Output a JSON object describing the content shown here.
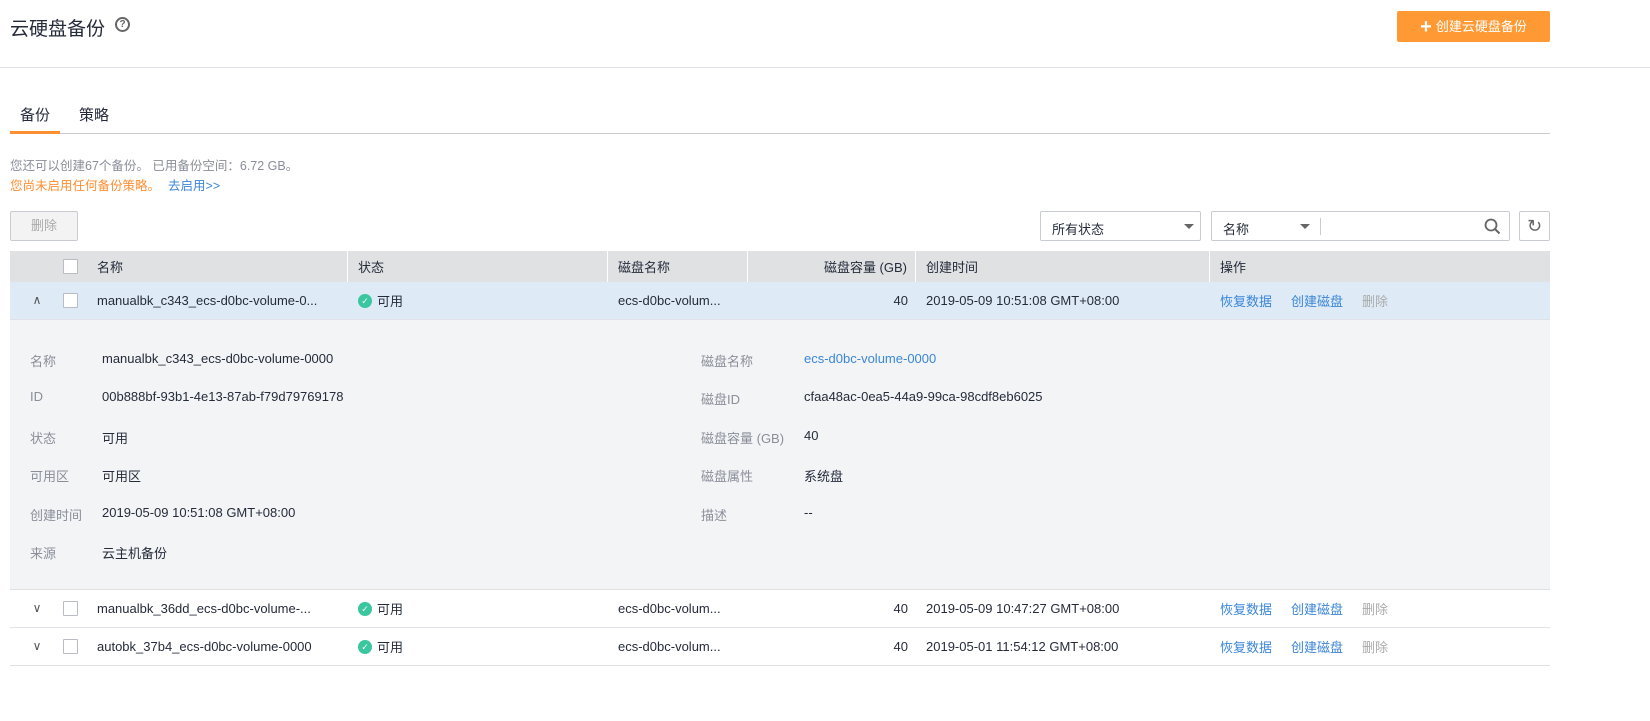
{
  "header": {
    "title": "云硬盘备份",
    "help_icon": "question-circle-icon",
    "create_button": "创建云硬盘备份",
    "accent": "#ff9933"
  },
  "tabs": [
    {
      "label": "备份"
    },
    {
      "label": "策略"
    }
  ],
  "info": {
    "quota": "您还可以创建67个备份。 已用备份空间：6.72 GB。",
    "policy_warning": "您尚未启用任何备份策略。",
    "policy_link": "去启用>>"
  },
  "toolbar": {
    "delete": "删除",
    "status_filter": "所有状态",
    "search_field": "名称",
    "search_placeholder": ""
  },
  "table": {
    "columns": [
      "名称",
      "状态",
      "磁盘名称",
      "磁盘容量 (GB)",
      "创建时间",
      "操作"
    ],
    "rows": [
      {
        "name": "manualbk_c343_ecs-d0bc-volume-0...",
        "status": "可用",
        "disk": "ecs-d0bc-volum...",
        "capacity": "40",
        "created": "2019-05-09 10:51:08 GMT+08:00",
        "expanded": true
      },
      {
        "name": "manualbk_36dd_ecs-d0bc-volume-...",
        "status": "可用",
        "disk": "ecs-d0bc-volum...",
        "capacity": "40",
        "created": "2019-05-09 10:47:27 GMT+08:00",
        "expanded": false
      },
      {
        "name": "autobk_37b4_ecs-d0bc-volume-0000",
        "status": "可用",
        "disk": "ecs-d0bc-volum...",
        "capacity": "40",
        "created": "2019-05-01 11:54:12 GMT+08:00",
        "expanded": false
      }
    ],
    "actions": {
      "restore": "恢复数据",
      "create_disk": "创建磁盘",
      "delete": "删除"
    }
  },
  "detail": {
    "left": [
      {
        "label": "名称",
        "value": "manualbk_c343_ecs-d0bc-volume-0000"
      },
      {
        "label": "ID",
        "value": "00b888bf-93b1-4e13-87ab-f79d79769178"
      },
      {
        "label": "状态",
        "value": "可用"
      },
      {
        "label": "可用区",
        "value": "可用区"
      },
      {
        "label": "创建时间",
        "value": "2019-05-09 10:51:08 GMT+08:00"
      },
      {
        "label": "来源",
        "value": "云主机备份"
      }
    ],
    "right": [
      {
        "label": "磁盘名称",
        "value": "ecs-d0bc-volume-0000"
      },
      {
        "label": "磁盘ID",
        "value": "cfaa48ac-0ea5-44a9-99ca-98cdf8eb6025"
      },
      {
        "label": "磁盘容量 (GB)",
        "value": "40"
      },
      {
        "label": "磁盘属性",
        "value": "系统盘"
      },
      {
        "label": "描述",
        "value": "--"
      }
    ]
  }
}
